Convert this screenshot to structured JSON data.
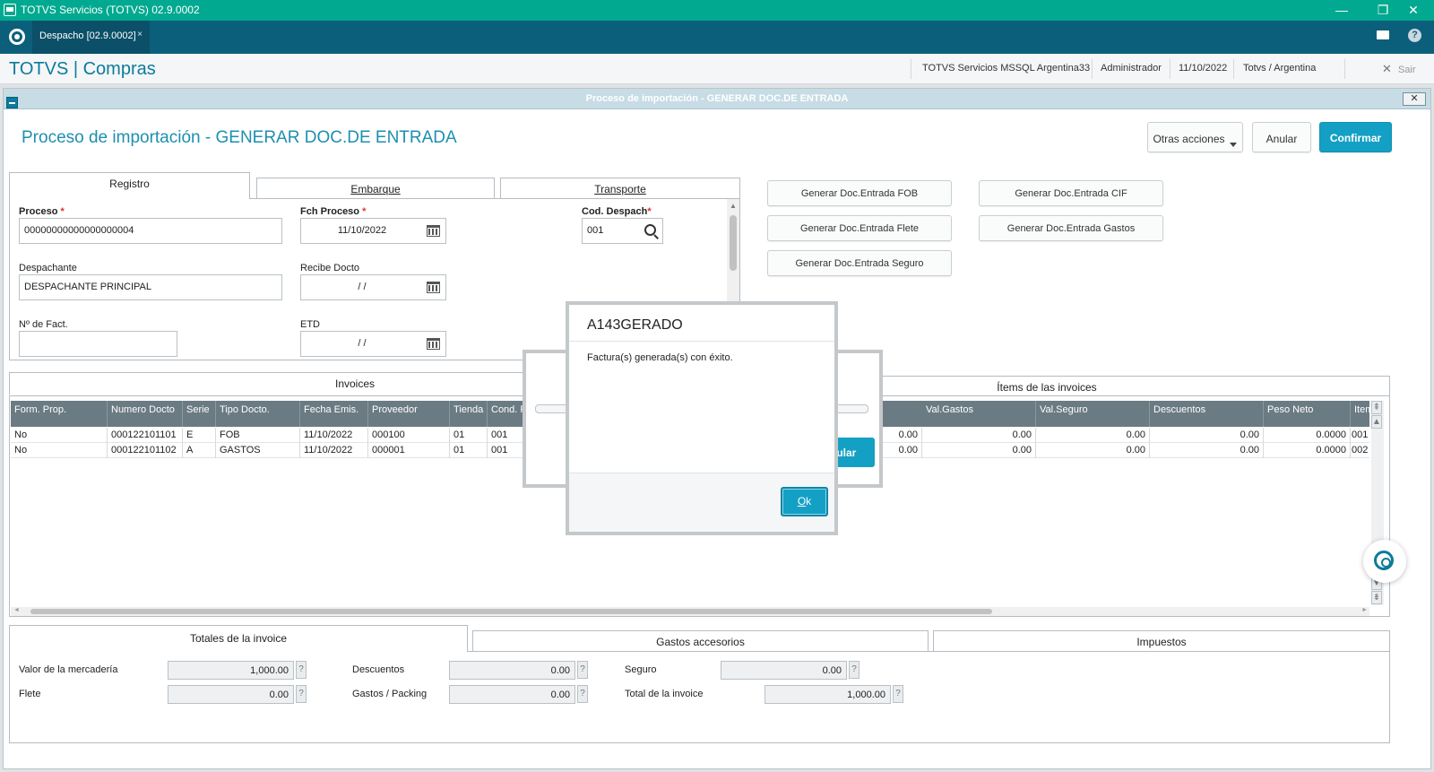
{
  "window": {
    "title": "TOTVS Servicios (TOTVS) 02.9.0002",
    "minimize": "—",
    "maximize": "❐",
    "close": "✕"
  },
  "tabbar": {
    "tab_label": "Despacho [02.9.0002]",
    "tab_close": "×",
    "help": "?"
  },
  "header": {
    "brand": "TOTVS | Compras",
    "environment": "TOTVS Servicios MSSQL Argentina33",
    "user": "Administrador",
    "date": "11/10/2022",
    "branch": "Totvs / Argentina",
    "logout_icon": "✕",
    "logout": "Sair"
  },
  "dialog": {
    "title": "Proceso de importación - GENERAR DOC.DE ENTRADA",
    "close": "✕",
    "page_title": "Proceso de importación - GENERAR DOC.DE ENTRADA",
    "actions": {
      "more": "Otras acciones",
      "cancel": "Anular",
      "confirm": "Confirmar"
    }
  },
  "top_tabs": {
    "registro": "Registro",
    "embarque": "Embarque",
    "transporte": "Transporte"
  },
  "form": {
    "proceso_label": "Proceso",
    "proceso_value": "00000000000000000004",
    "fch_proceso_label": "Fch Proceso",
    "fch_proceso_value": "11/10/2022",
    "cod_despach_label": "Cod. Despach",
    "cod_despach_value": "001",
    "despachante_label": "Despachante",
    "despachante_value": "DESPACHANTE PRINCIPAL",
    "recibe_docto_label": "Recibe Docto",
    "recibe_docto_value": "/ /",
    "nro_fact_label": "Nº de Fact.",
    "nro_fact_value": "",
    "etd_label": "ETD",
    "etd_value": "/ /",
    "required_mark": "*"
  },
  "generate_buttons": {
    "fob": "Generar Doc.Entrada FOB",
    "cif": "Generar Doc.Entrada CIF",
    "flete": "Generar Doc.Entrada Flete",
    "gastos": "Generar Doc.Entrada Gastos",
    "seguro": "Generar Doc.Entrada Seguro"
  },
  "grid_tabs": {
    "invoices": "Invoices",
    "items": "Ítems de las invoices"
  },
  "grid": {
    "headers_left": [
      "Form. Prop.",
      "Numero Docto",
      "Serie",
      "Tipo Docto.",
      "Fecha Emis.",
      "Proveedor",
      "Tienda",
      "Cond. P"
    ],
    "headers_right": [
      "Val.Gastos",
      "Val.Seguro",
      "Descuentos",
      "Peso Neto",
      "Item"
    ],
    "rows": [
      {
        "left": [
          "No",
          "000122101101",
          "E",
          "FOB",
          "11/10/2022",
          "000100",
          "01",
          "001"
        ],
        "right": [
          "0.00",
          "0.00",
          "0.00",
          "0.00",
          "0.0000",
          "001"
        ]
      },
      {
        "left": [
          "No",
          "000122101102",
          "A",
          "GASTOS",
          "11/10/2022",
          "000001",
          "01",
          "001"
        ],
        "right": [
          "0.00",
          "0.00",
          "0.00",
          "0.00",
          "0.0000",
          "002"
        ]
      }
    ]
  },
  "bottom_tabs": {
    "totales": "Totales de la invoice",
    "gastos": "Gastos accesorios",
    "impuestos": "Impuestos"
  },
  "totals": {
    "valor_label": "Valor de la mercadería",
    "valor_value": "1,000.00",
    "flete_label": "Flete",
    "flete_value": "0.00",
    "descuentos_label": "Descuentos",
    "descuentos_value": "0.00",
    "gastos_label": "Gastos / Packing",
    "gastos_value": "0.00",
    "seguro_label": "Seguro",
    "seguro_value": "0.00",
    "total_label": "Total de la invoice",
    "total_value": "1,000.00",
    "help_mark": "?"
  },
  "progress_popup": {
    "button_fragment": "nular"
  },
  "message_popup": {
    "title": "A143GERADO",
    "message": "Factura(s) generada(s) con éxito.",
    "ok_mnemonic": "O",
    "ok_rest": "k"
  },
  "scroll": {
    "up": "▲",
    "down": "▼",
    "first": "⇞",
    "last": "⇟",
    "left": "◄",
    "right": "►"
  },
  "colors": {
    "accent": "#14a0c4",
    "titlebar": "#00a98f",
    "tabbar": "#0c5f7a",
    "brand": "#0c7b9c",
    "grid_header": "#6b7b83"
  }
}
